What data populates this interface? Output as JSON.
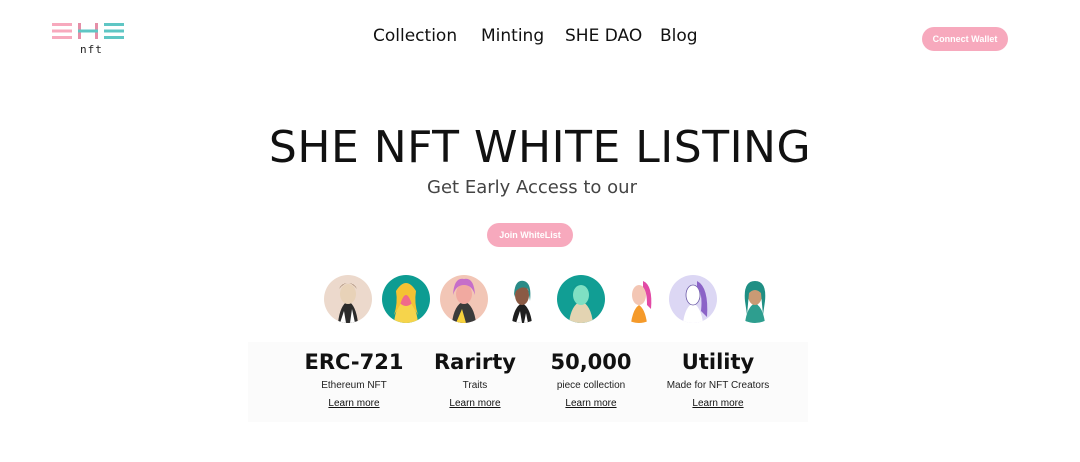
{
  "logo": {
    "mark": "SHE",
    "sub": "nft"
  },
  "nav": {
    "items": [
      {
        "label": "Collection"
      },
      {
        "label": "Minting"
      },
      {
        "label": "SHE DAO"
      },
      {
        "label": "Blog"
      }
    ],
    "connect_wallet_label": "Connect Wallet"
  },
  "hero": {
    "title": "SHE NFT WHITE LISTING",
    "subtitle": "Get Early Access to our",
    "join_label": "Join WhiteList"
  },
  "avatars": [
    {
      "name": "avatar-1"
    },
    {
      "name": "avatar-2"
    },
    {
      "name": "avatar-3"
    },
    {
      "name": "avatar-4"
    },
    {
      "name": "avatar-5"
    },
    {
      "name": "avatar-6"
    },
    {
      "name": "avatar-7"
    },
    {
      "name": "avatar-8"
    }
  ],
  "stats": [
    {
      "value": "ERC-721",
      "label": "Ethereum NFT",
      "link": "Learn more"
    },
    {
      "value": "Rarirty",
      "label": "Traits",
      "link": "Learn more"
    },
    {
      "value": "50,000",
      "label": "piece collection",
      "link": "Learn more"
    },
    {
      "value": "Utility",
      "label": "Made for NFT Creators",
      "link": "Learn more"
    }
  ],
  "colors": {
    "accent_pink": "#f7a9bd",
    "logo_teal": "#5fc6c4",
    "text": "#111111"
  }
}
